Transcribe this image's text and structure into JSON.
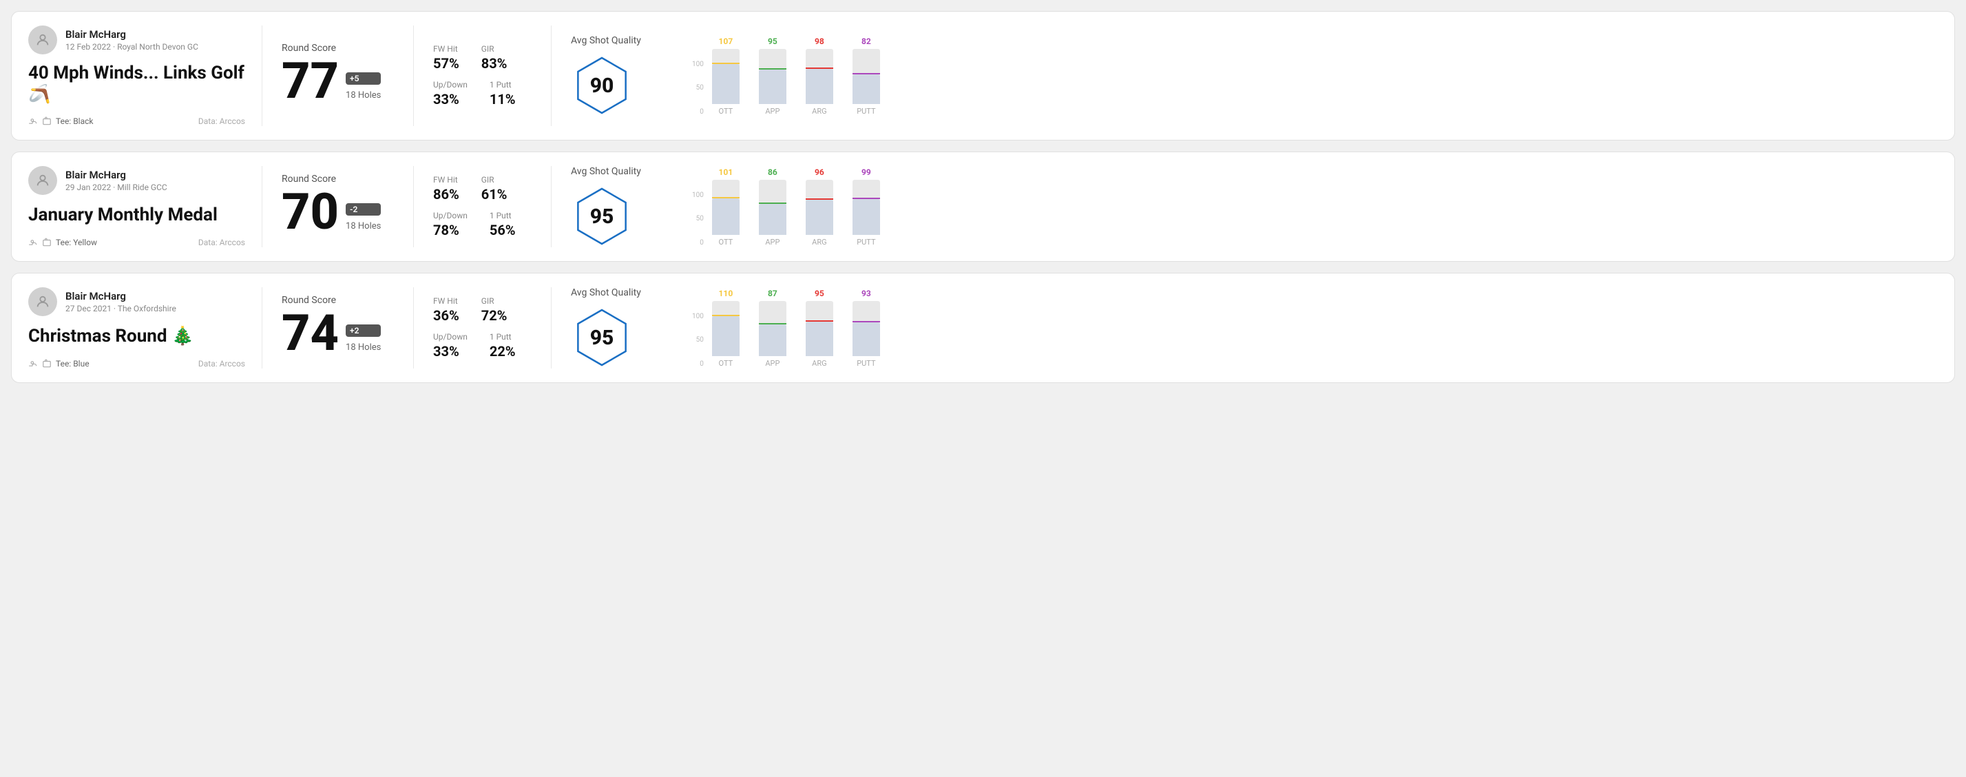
{
  "rounds": [
    {
      "id": "round1",
      "user": {
        "name": "Blair McHarg",
        "date_course": "12 Feb 2022 · Royal North Devon GC"
      },
      "title": "40 Mph Winds... Links Golf 🪃",
      "tee": "Tee: Black",
      "data_source": "Data: Arccos",
      "score": {
        "label": "Round Score",
        "number": "77",
        "badge": "+5",
        "holes": "18 Holes"
      },
      "stats": {
        "fw_hit_label": "FW Hit",
        "fw_hit_value": "57%",
        "gir_label": "GIR",
        "gir_value": "83%",
        "updown_label": "Up/Down",
        "updown_value": "33%",
        "oneputt_label": "1 Putt",
        "oneputt_value": "11%"
      },
      "quality": {
        "label": "Avg Shot Quality",
        "value": "90"
      },
      "chart": {
        "bars": [
          {
            "label": "OTT",
            "top_value": "107",
            "top_color": "#f5c842",
            "fill_pct": 72
          },
          {
            "label": "APP",
            "top_value": "95",
            "top_color": "#4caf50",
            "fill_pct": 62
          },
          {
            "label": "ARG",
            "top_value": "98",
            "top_color": "#e53935",
            "fill_pct": 64
          },
          {
            "label": "PUTT",
            "top_value": "82",
            "top_color": "#ab47bc",
            "fill_pct": 53
          }
        ],
        "y_labels": [
          "100",
          "50",
          "0"
        ]
      }
    },
    {
      "id": "round2",
      "user": {
        "name": "Blair McHarg",
        "date_course": "29 Jan 2022 · Mill Ride GCC"
      },
      "title": "January Monthly Medal",
      "tee": "Tee: Yellow",
      "data_source": "Data: Arccos",
      "score": {
        "label": "Round Score",
        "number": "70",
        "badge": "-2",
        "holes": "18 Holes"
      },
      "stats": {
        "fw_hit_label": "FW Hit",
        "fw_hit_value": "86%",
        "gir_label": "GIR",
        "gir_value": "61%",
        "updown_label": "Up/Down",
        "updown_value": "78%",
        "oneputt_label": "1 Putt",
        "oneputt_value": "56%"
      },
      "quality": {
        "label": "Avg Shot Quality",
        "value": "95"
      },
      "chart": {
        "bars": [
          {
            "label": "OTT",
            "top_value": "101",
            "top_color": "#f5c842",
            "fill_pct": 66
          },
          {
            "label": "APP",
            "top_value": "86",
            "top_color": "#4caf50",
            "fill_pct": 56
          },
          {
            "label": "ARG",
            "top_value": "96",
            "top_color": "#e53935",
            "fill_pct": 63
          },
          {
            "label": "PUTT",
            "top_value": "99",
            "top_color": "#ab47bc",
            "fill_pct": 65
          }
        ],
        "y_labels": [
          "100",
          "50",
          "0"
        ]
      }
    },
    {
      "id": "round3",
      "user": {
        "name": "Blair McHarg",
        "date_course": "27 Dec 2021 · The Oxfordshire"
      },
      "title": "Christmas Round 🎄",
      "tee": "Tee: Blue",
      "data_source": "Data: Arccos",
      "score": {
        "label": "Round Score",
        "number": "74",
        "badge": "+2",
        "holes": "18 Holes"
      },
      "stats": {
        "fw_hit_label": "FW Hit",
        "fw_hit_value": "36%",
        "gir_label": "GIR",
        "gir_value": "72%",
        "updown_label": "Up/Down",
        "updown_value": "33%",
        "oneputt_label": "1 Putt",
        "oneputt_value": "22%"
      },
      "quality": {
        "label": "Avg Shot Quality",
        "value": "95"
      },
      "chart": {
        "bars": [
          {
            "label": "OTT",
            "top_value": "110",
            "top_color": "#f5c842",
            "fill_pct": 72
          },
          {
            "label": "APP",
            "top_value": "87",
            "top_color": "#4caf50",
            "fill_pct": 57
          },
          {
            "label": "ARG",
            "top_value": "95",
            "top_color": "#e53935",
            "fill_pct": 62
          },
          {
            "label": "PUTT",
            "top_value": "93",
            "top_color": "#ab47bc",
            "fill_pct": 61
          }
        ],
        "y_labels": [
          "100",
          "50",
          "0"
        ]
      }
    }
  ]
}
